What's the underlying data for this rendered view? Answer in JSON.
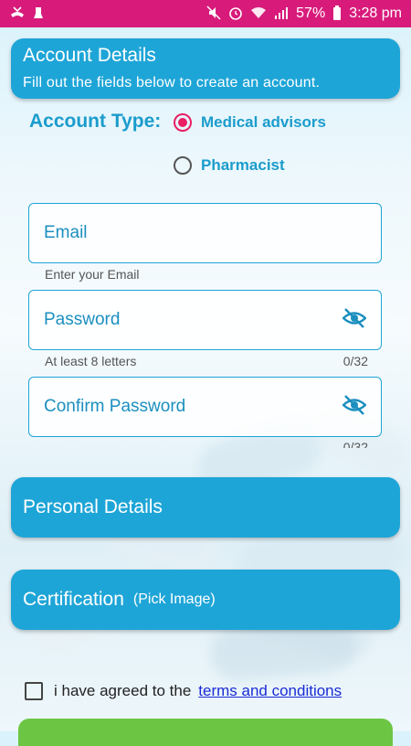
{
  "status_bar": {
    "battery": "57%",
    "time": "3:28 pm"
  },
  "account_card": {
    "title": "Account Details",
    "subtitle": "Fill out the fields below to create an account."
  },
  "account_type": {
    "label": "Account Type:",
    "options": [
      {
        "label": "Medical advisors",
        "selected": true
      },
      {
        "label": "Pharmacist",
        "selected": false
      }
    ]
  },
  "fields": {
    "email": {
      "label": "Email",
      "helper": "Enter your Email"
    },
    "password": {
      "label": "Password",
      "helper": "At least 8 letters",
      "counter": "0/32"
    },
    "confirm_password": {
      "label": "Confirm Password",
      "counter": "0/32"
    }
  },
  "personal_card": {
    "title": "Personal Details"
  },
  "certification_card": {
    "title": "Certification",
    "subtitle": "(Pick Image)"
  },
  "terms": {
    "text": "i have agreed to the",
    "link": "terms and conditions",
    "checked": false
  },
  "colors": {
    "status_bar": "#d81b7b",
    "card": "#1ea5d7",
    "accent_text": "#1b9ccc",
    "radio_selected": "#e91e63",
    "submit_button": "#6cc644",
    "link": "#1a2bd6"
  }
}
